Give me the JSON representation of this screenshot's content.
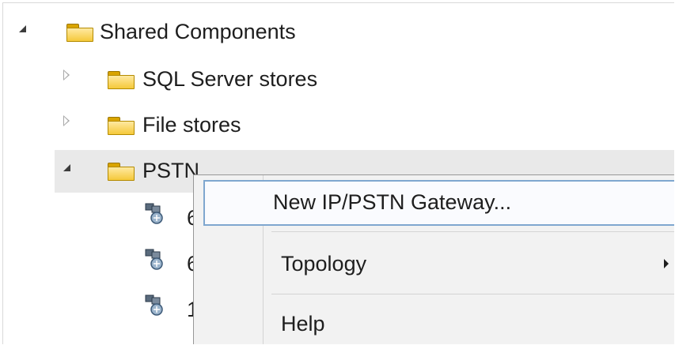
{
  "tree": {
    "root": {
      "label": "Shared Components",
      "expanded": true,
      "icon": "folder-icon"
    },
    "children": [
      {
        "label": "SQL Server stores",
        "expanded": false,
        "icon": "folder-icon"
      },
      {
        "label": "File stores",
        "expanded": false,
        "icon": "folder-icon"
      },
      {
        "label": "PSTN gateways",
        "visible_label": "PSTN",
        "expanded": true,
        "selected": true,
        "icon": "folder-icon"
      }
    ],
    "gateway_items": [
      {
        "visible_label": "6",
        "icon": "gateway-icon"
      },
      {
        "visible_label": "6",
        "icon": "gateway-icon"
      },
      {
        "visible_label": "1",
        "icon": "gateway-icon"
      }
    ]
  },
  "context_menu": {
    "items": [
      {
        "label": "New IP/PSTN Gateway...",
        "highlighted": true
      },
      {
        "label": "Topology",
        "has_submenu": true
      },
      {
        "label": "Help"
      }
    ]
  },
  "colors": {
    "selection": "#e9e9e9",
    "menu_background": "#f2f2f2",
    "menu_highlight_border": "#7fa7cf",
    "folder_yellow": "#f5c93a"
  }
}
